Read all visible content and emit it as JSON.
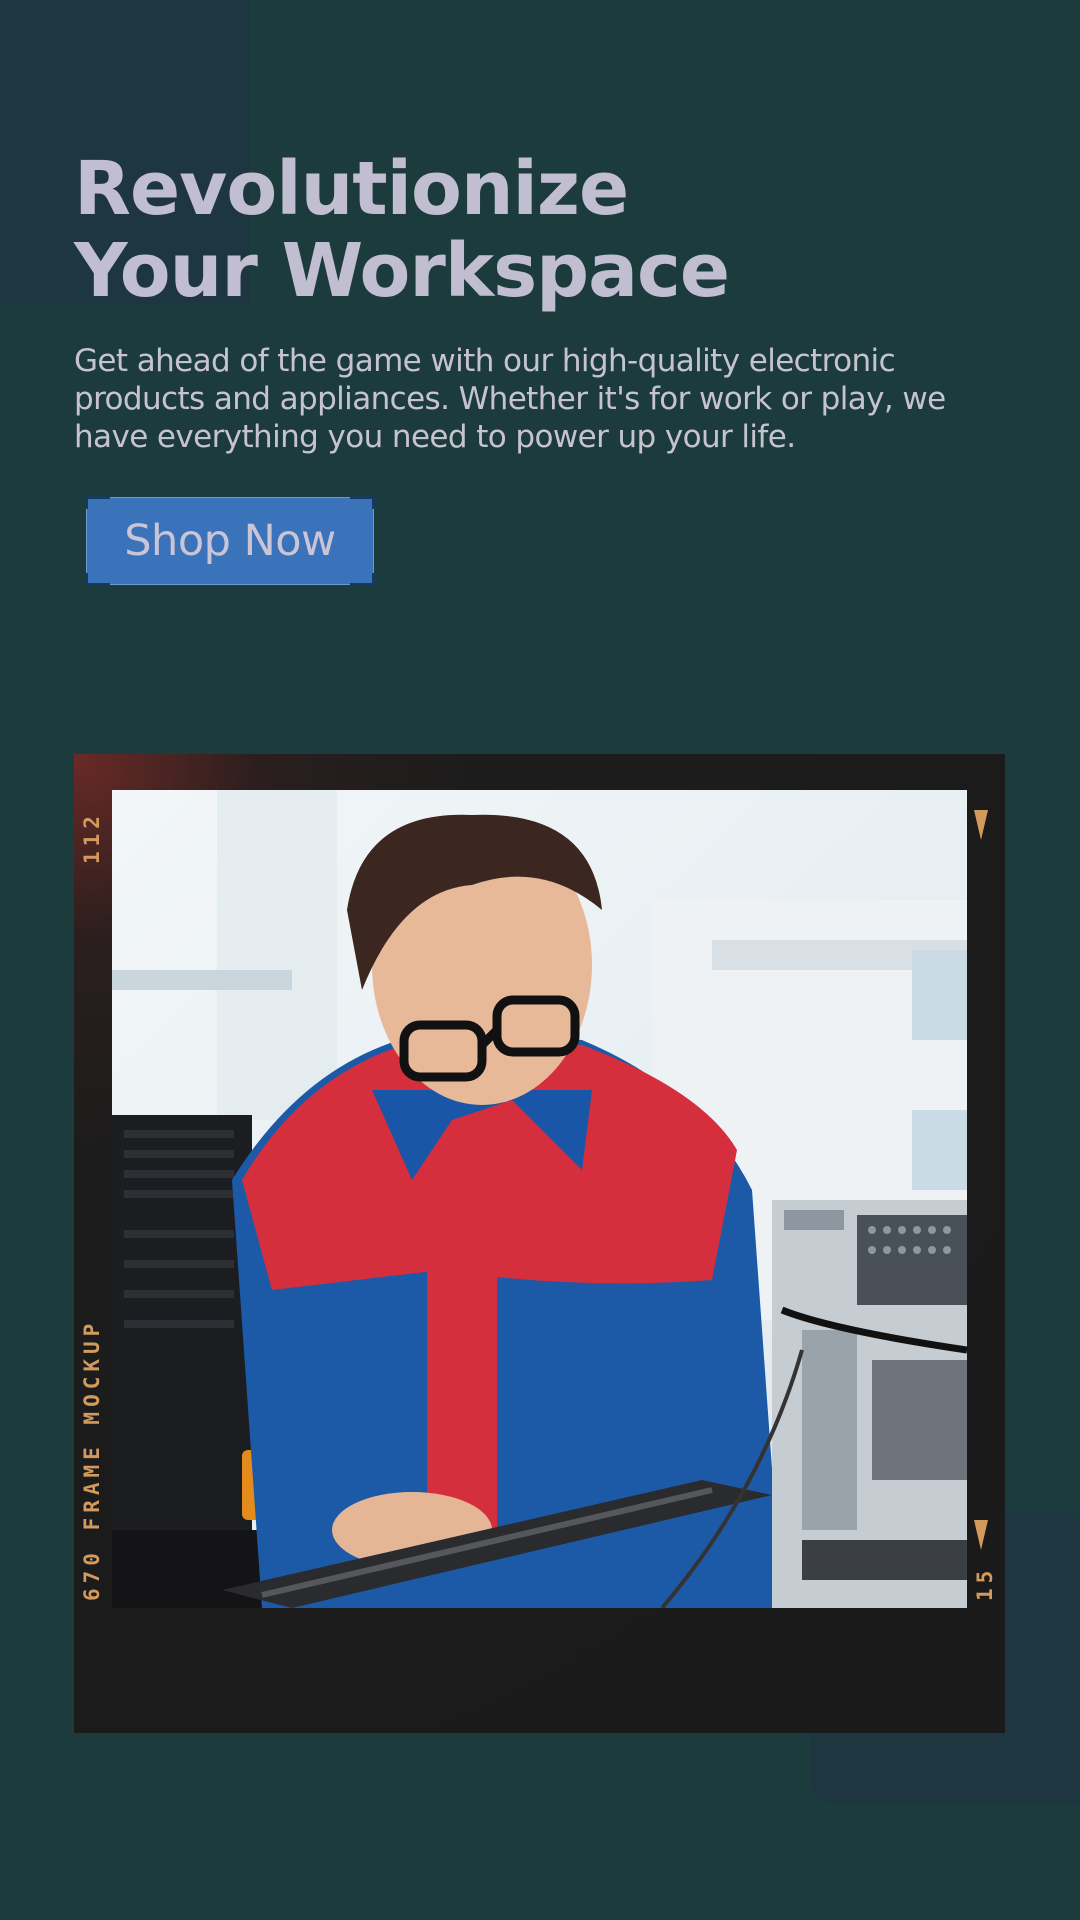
{
  "hero": {
    "title": "Revolutionize Your Workspace",
    "description": "Get ahead of the game with our high-quality electronic products and appliances. Whether it's for work or play, we have everything you need to power up your life.",
    "cta_label": "Shop Now"
  },
  "frame": {
    "left_top_number": "112",
    "left_bottom_text": "670 FRAME MOCKUP",
    "right_bottom_number": "15"
  },
  "colors": {
    "background": "#1b3b3d",
    "accent_panel": "#1d3640",
    "headline": "#c2bed1",
    "button": "#3b73bb",
    "frame_marks": "#d39a5e"
  }
}
